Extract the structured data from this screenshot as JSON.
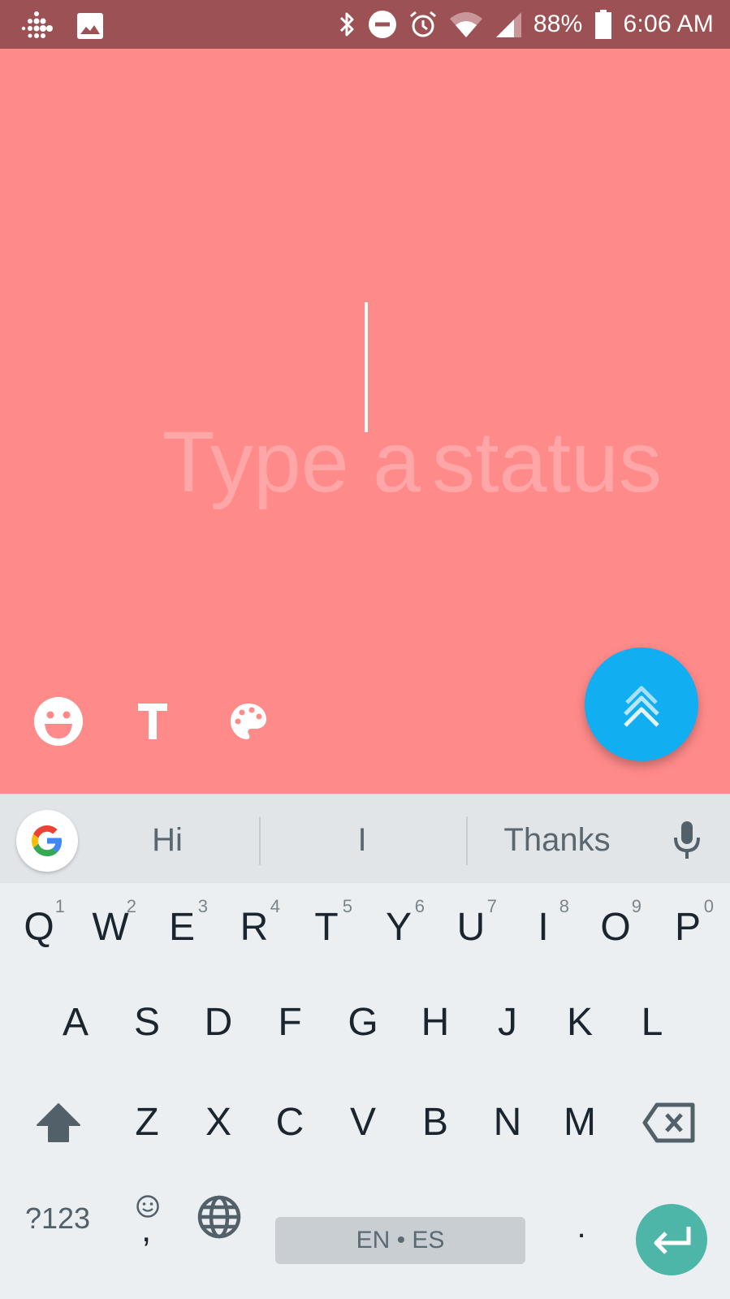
{
  "status_bar": {
    "left_icons": [
      "fitbit-icon",
      "image-icon"
    ],
    "right_icons": [
      "bluetooth-icon",
      "do-not-disturb-icon",
      "alarm-icon",
      "wifi-icon",
      "cell-signal-icon"
    ],
    "battery_percent": "88%",
    "battery_icon": "battery-icon",
    "time": "6:06 AM"
  },
  "compose": {
    "background_color": "#ff8a8a",
    "placeholder_part1": "Type a",
    "placeholder_part2": "status",
    "tools": [
      {
        "name": "emoji-button",
        "icon": "smiley-icon"
      },
      {
        "name": "text-style-button",
        "icon": "text-t-icon",
        "label": "T"
      },
      {
        "name": "color-palette-button",
        "icon": "palette-icon"
      }
    ],
    "send_fab": {
      "icon": "send-chevrons-icon",
      "color": "#12aef2"
    }
  },
  "keyboard": {
    "suggestions": [
      "Hi",
      "I",
      "Thanks"
    ],
    "google_button": "google-g-icon",
    "mic_icon": "microphone-icon",
    "row1": [
      {
        "key": "Q",
        "hint": "1"
      },
      {
        "key": "W",
        "hint": "2"
      },
      {
        "key": "E",
        "hint": "3"
      },
      {
        "key": "R",
        "hint": "4"
      },
      {
        "key": "T",
        "hint": "5"
      },
      {
        "key": "Y",
        "hint": "6"
      },
      {
        "key": "U",
        "hint": "7"
      },
      {
        "key": "I",
        "hint": "8"
      },
      {
        "key": "O",
        "hint": "9"
      },
      {
        "key": "P",
        "hint": "0"
      }
    ],
    "row2": [
      "A",
      "S",
      "D",
      "F",
      "G",
      "H",
      "J",
      "K",
      "L"
    ],
    "row3": [
      "Z",
      "X",
      "C",
      "V",
      "B",
      "N",
      "M"
    ],
    "symbols_label": "?123",
    "comma_label": ",",
    "space_label": "EN • ES",
    "period_label": ".",
    "enter_color": "#4db6a9"
  }
}
